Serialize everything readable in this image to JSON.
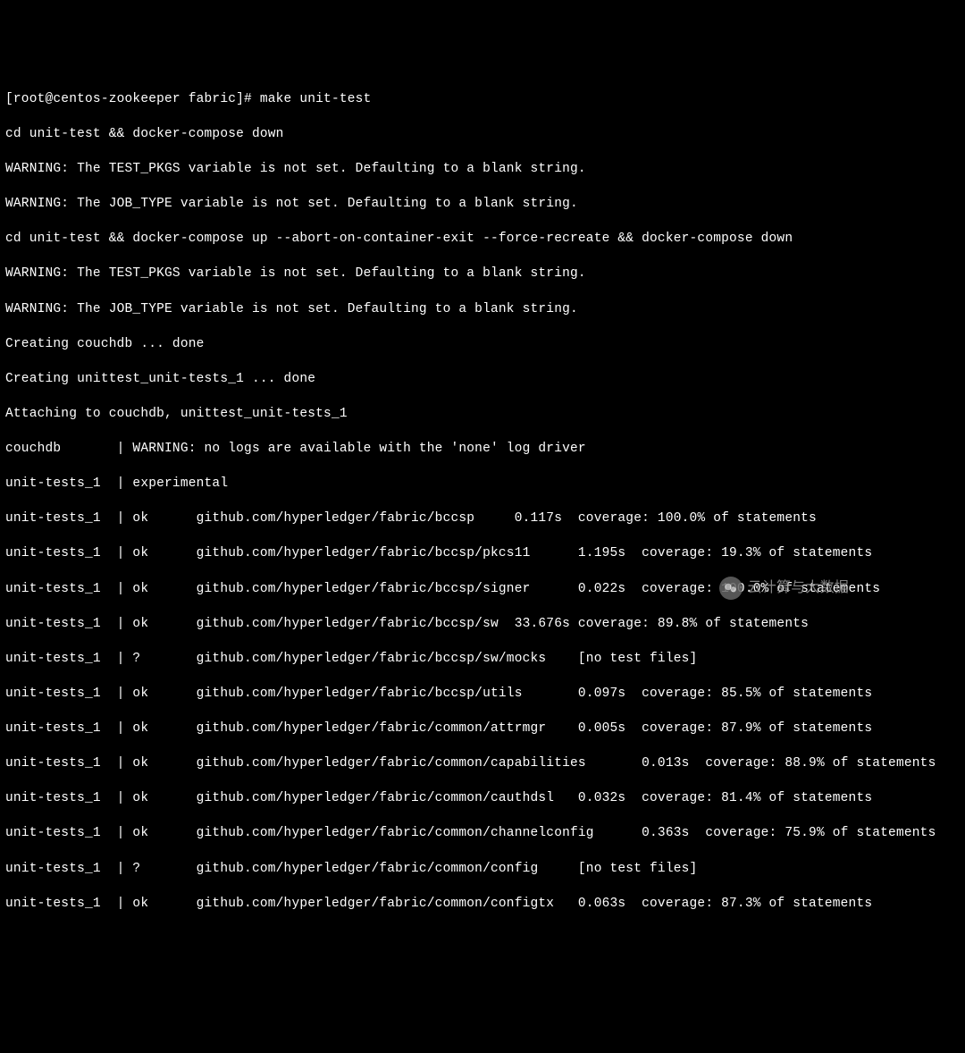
{
  "prompt": "[root@centos-zookeeper fabric]# make unit-test",
  "lines": [
    "cd unit-test && docker-compose down",
    "WARNING: The TEST_PKGS variable is not set. Defaulting to a blank string.",
    "WARNING: The JOB_TYPE variable is not set. Defaulting to a blank string.",
    "cd unit-test && docker-compose up --abort-on-container-exit --force-recreate && docker-compose down",
    "WARNING: The TEST_PKGS variable is not set. Defaulting to a blank string.",
    "WARNING: The JOB_TYPE variable is not set. Defaulting to a blank string.",
    "Creating couchdb ... done",
    "Creating unittest_unit-tests_1 ... done",
    "Attaching to couchdb, unittest_unit-tests_1",
    "couchdb       | WARNING: no logs are available with the 'none' log driver",
    "unit-tests_1  | experimental",
    "unit-tests_1  | ok      github.com/hyperledger/fabric/bccsp     0.117s  coverage: 100.0% of statements",
    "unit-tests_1  | ok      github.com/hyperledger/fabric/bccsp/pkcs11      1.195s  coverage: 19.3% of statements",
    "unit-tests_1  | ok      github.com/hyperledger/fabric/bccsp/signer      0.022s  coverage: 100.0% of statements",
    "unit-tests_1  | ok      github.com/hyperledger/fabric/bccsp/sw  33.676s coverage: 89.8% of statements",
    "unit-tests_1  | ?       github.com/hyperledger/fabric/bccsp/sw/mocks    [no test files]",
    "unit-tests_1  | ok      github.com/hyperledger/fabric/bccsp/utils       0.097s  coverage: 85.5% of statements",
    "unit-tests_1  | ok      github.com/hyperledger/fabric/common/attrmgr    0.005s  coverage: 87.9% of statements",
    "unit-tests_1  | ok      github.com/hyperledger/fabric/common/capabilities       0.013s  coverage: 88.9% of statements",
    "unit-tests_1  | ok      github.com/hyperledger/fabric/common/cauthdsl   0.032s  coverage: 81.4% of statements",
    "unit-tests_1  | ok      github.com/hyperledger/fabric/common/channelconfig      0.363s  coverage: 75.9% of statements",
    "unit-tests_1  | ?       github.com/hyperledger/fabric/common/config     [no test files]",
    "unit-tests_1  | ok      github.com/hyperledger/fabric/common/configtx   0.063s  coverage: 87.3% of statements"
  ],
  "watermark": {
    "text": "云计算与大数据"
  }
}
